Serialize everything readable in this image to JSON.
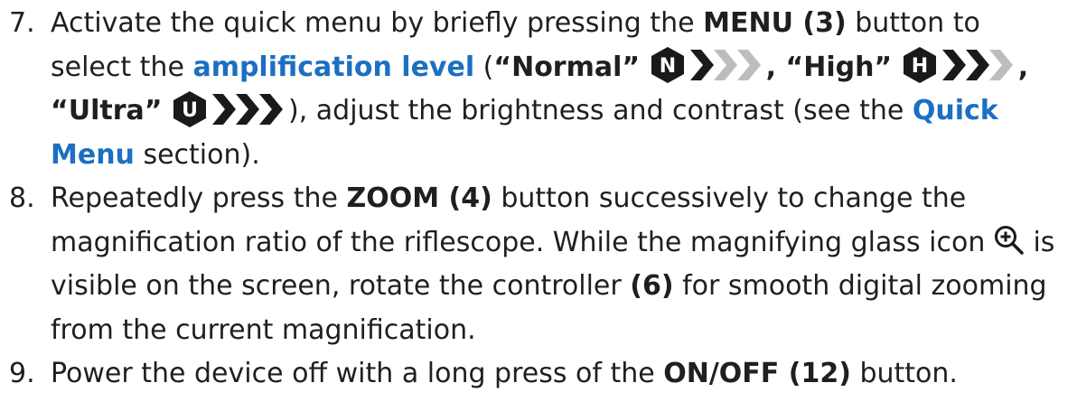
{
  "steps": [
    {
      "number": "7.",
      "p1": "Activate the quick menu by briefly pressing the ",
      "b1": "MENU (3)",
      "p2": " button to select the ",
      "link1": "amplification level",
      "p3": " (",
      "b2": "“Normal”",
      "b3": ", “High”",
      "b4": ", “Ultra”",
      "p4": "), adjust the brightness and contrast (see the ",
      "link2": "Quick Menu",
      "p5": " section)."
    },
    {
      "number": "8.",
      "p1": "Repeatedly  press the ",
      "b1": "ZOOM (4)",
      "p2": " button successively to change the magnification ratio of the riflescope. While the magnifying glass icon ",
      "p3": " is visible on the screen, rotate the controller ",
      "b2": "(6)",
      "p4": " for smooth digital zooming from the current magnification."
    },
    {
      "number": "9.",
      "p1": "Power the device off with a long press of the ",
      "b1": "ON/OFF (12)",
      "p2": " button."
    }
  ],
  "icons": [
    {
      "name": "amplification-normal-icon",
      "letter": "N",
      "chevrons_filled": 1
    },
    {
      "name": "amplification-high-icon",
      "letter": "H",
      "chevrons_filled": 2
    },
    {
      "name": "amplification-ultra-icon",
      "letter": "U",
      "chevrons_filled": 3
    },
    {
      "name": "zoom-magnifier-icon"
    }
  ],
  "colors": {
    "text": "#1f1f1f",
    "link": "#1c6fc2",
    "icon_dark": "#1a1a1a",
    "icon_light": "#bdbdbd"
  }
}
